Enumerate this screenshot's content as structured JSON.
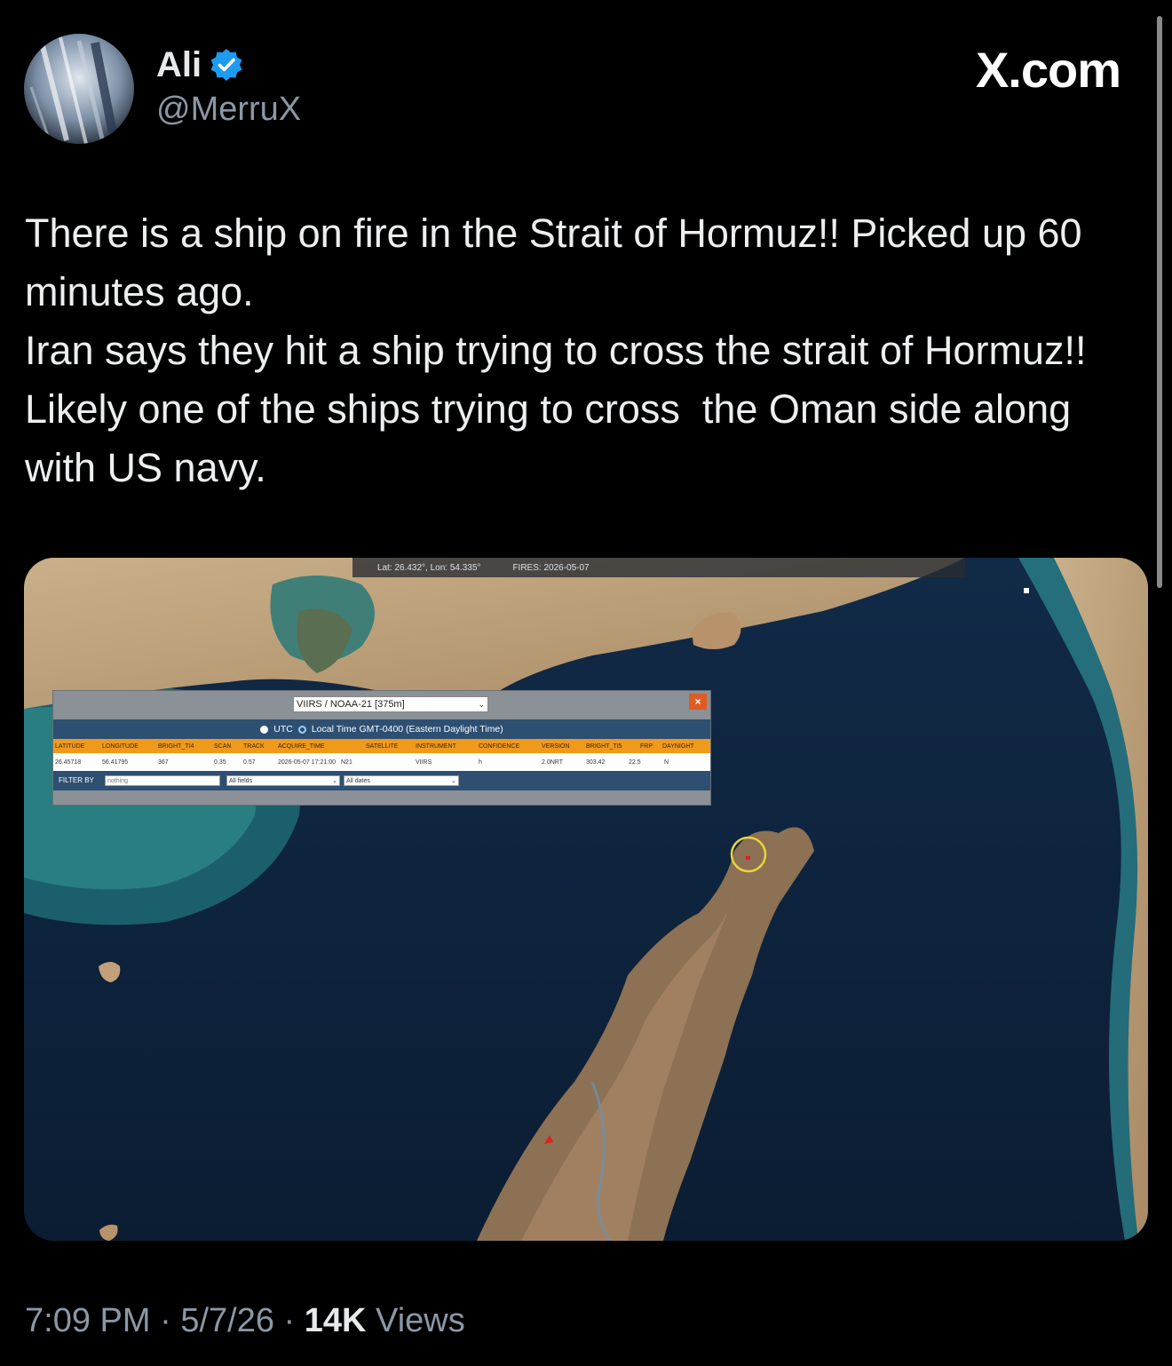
{
  "author": {
    "name": "Ali",
    "handle": "@MerruX",
    "verified": true,
    "verified_color": "#1d9bf0"
  },
  "brand": {
    "logo_text": "X.com"
  },
  "tweet": {
    "paragraphs": [
      "There is a ship on fire in the Strait of Hormuz!! Picked up 60 minutes ago.",
      "Iran says they hit a ship trying to cross the strait of Hormuz!! Likely one of the ships trying to cross  the Oman side along with US navy."
    ]
  },
  "media": {
    "topbar": {
      "coords": "Lat: 26.432°, Lon: 54.335°",
      "fires": "FIRES: 2026-05-07"
    },
    "panel": {
      "source_select": "VIIRS / NOAA-21 [375m]",
      "close_label": "×",
      "time_options": [
        "UTC",
        "Local Time GMT-0400 (Eastern Daylight Time)"
      ],
      "selected_time_option": "UTC",
      "columns": [
        "LATITUDE",
        "LONGITUDE",
        "BRIGHT_TI4",
        "SCAN",
        "TRACK",
        "ACQUIRE_TIME",
        "SATELLITE",
        "INSTRUMENT",
        "CONFIDENCE",
        "VERSION",
        "BRIGHT_TI5",
        "FRP",
        "DAYNIGHT"
      ],
      "row": [
        "26.45718",
        "56.41795",
        "367",
        "0.35",
        "0.57",
        "2026-05-07 17:21:00",
        "N21",
        "VIIRS",
        "h",
        "2.0NRT",
        "303.42",
        "22.5",
        "N"
      ],
      "filter_label": "FILTER BY",
      "filter_placeholder": "nothing",
      "fields_select": "All fields",
      "dates_select": "All dates",
      "header_color": "#f09a1c",
      "bar_color": "#2d4f72"
    },
    "fire_marker_color": "#e8d43a"
  },
  "footer": {
    "time": "7:09 PM",
    "date": "5/7/26",
    "separator": "·",
    "views_count": "14K",
    "views_label": "Views"
  }
}
